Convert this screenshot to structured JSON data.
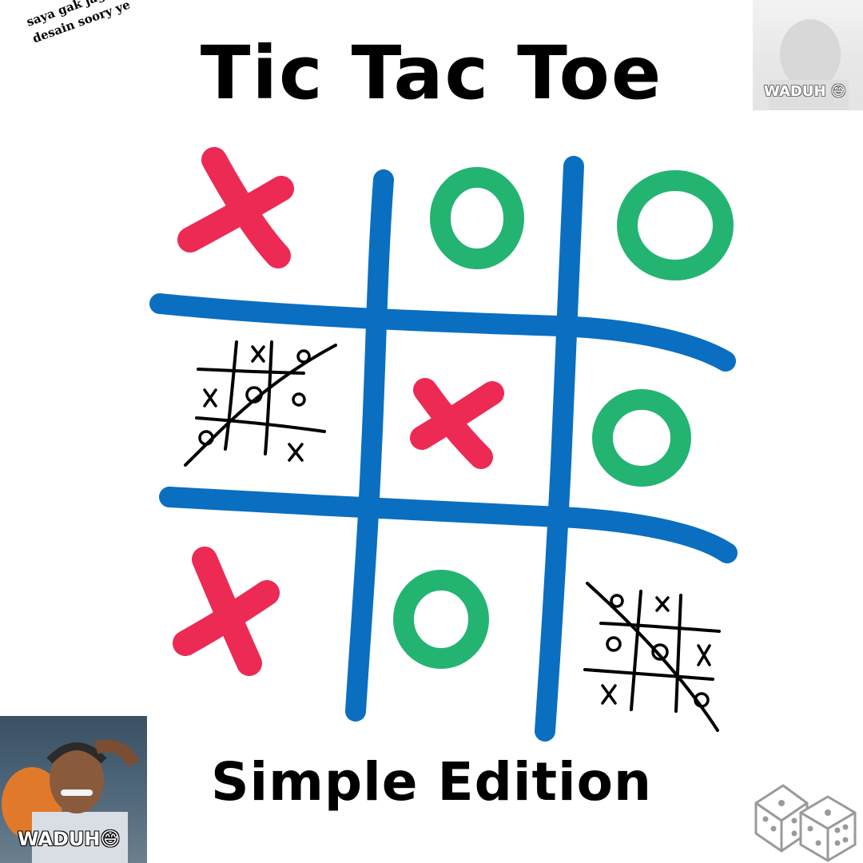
{
  "header": {
    "title": "Tic Tac Toe"
  },
  "footer": {
    "subtitle": "Simple Edition"
  },
  "note": {
    "line1": "saya gak jago",
    "line2": "desain soory ye"
  },
  "memes": {
    "top_label": "WADUH 😅",
    "bottom_label": "WADUH😅"
  },
  "board": {
    "cells": [
      "X",
      "O",
      "O",
      "mini-board",
      "X",
      "O",
      "X",
      "O",
      "mini-board"
    ]
  },
  "mini_boards": [
    {
      "marks": [
        "",
        "x",
        "o",
        "x",
        "o",
        "o",
        "o",
        "",
        "x"
      ]
    },
    {
      "marks": [
        "o",
        "x",
        "",
        "o",
        "o",
        "x",
        "x",
        "",
        "o"
      ]
    }
  ],
  "colors": {
    "grid": "#0a6fc0",
    "x": "#ec2a54",
    "o": "#23b472",
    "ink": "#000000",
    "dice": "#9a9a9a"
  }
}
